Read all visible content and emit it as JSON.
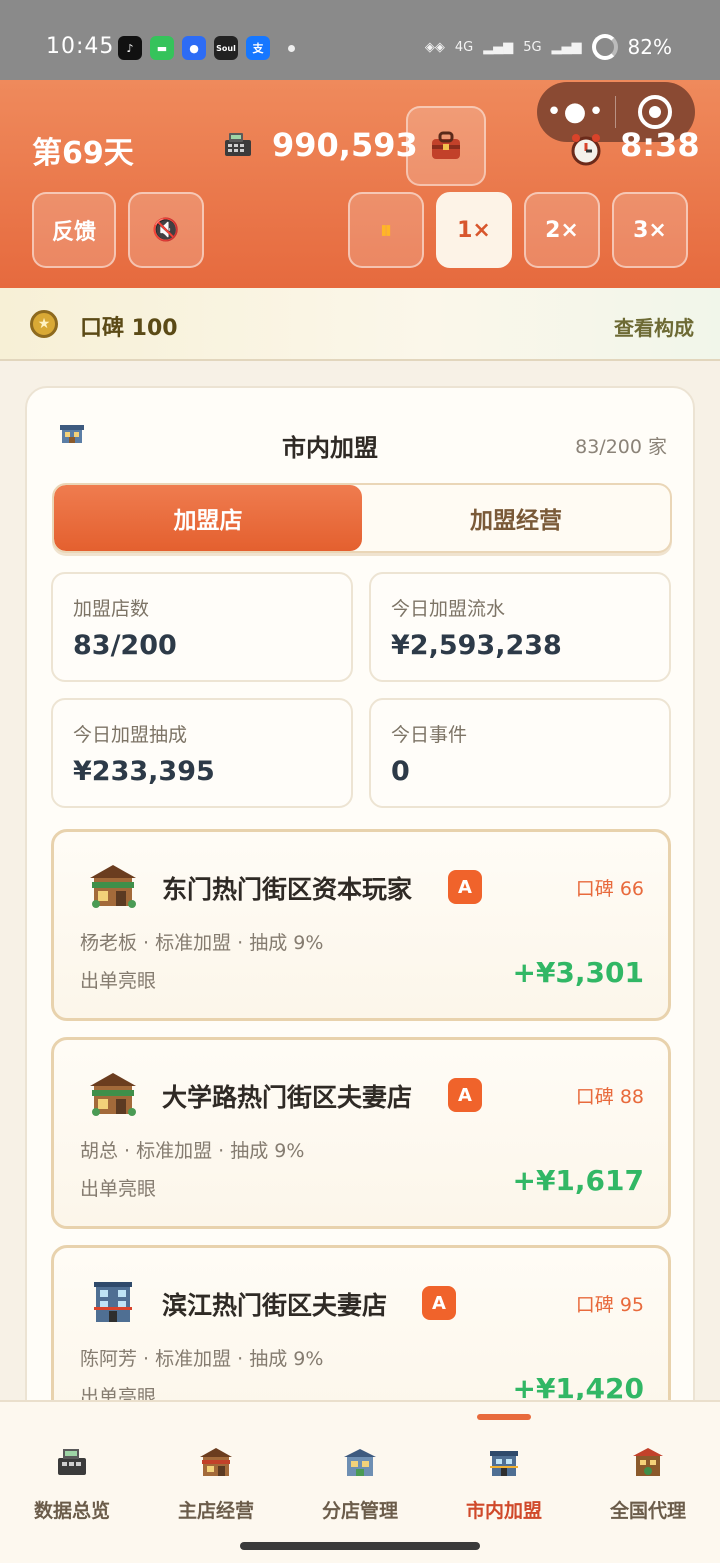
{
  "status_bar": {
    "time": "10:45",
    "battery": "82%",
    "apps": [
      {
        "icon": "tiktok-icon",
        "glyph": "♪",
        "color": "#111111"
      },
      {
        "icon": "messages-icon",
        "glyph": "▬",
        "color": "#35c35b"
      },
      {
        "icon": "browser-icon",
        "glyph": "●",
        "color": "#2d6cf5"
      },
      {
        "icon": "soul-icon",
        "glyph": "Soul",
        "color": "#222222"
      },
      {
        "icon": "alipay-icon",
        "glyph": "支",
        "color": "#1677ff"
      }
    ],
    "signal_text": [
      "4G",
      "5G"
    ]
  },
  "header": {
    "day": "第69天",
    "money": "990,593",
    "clock": "8:38",
    "buttons": {
      "feedback": "反馈",
      "mute_icon": "🔇",
      "pause_icon": "⏸",
      "speed_1": "1×",
      "speed_2": "2×",
      "speed_3": "3×"
    },
    "active_speed": "1×"
  },
  "capsule": {
    "more": "•●•"
  },
  "reputation": {
    "label": "口碑 100",
    "link": "查看构成"
  },
  "card": {
    "title": "市内加盟",
    "count": "83/200 家",
    "tabs": [
      "加盟店",
      "加盟经营"
    ],
    "active_tab": 0,
    "stats": [
      {
        "label": "加盟店数",
        "value": "83/200"
      },
      {
        "label": "今日加盟流水",
        "value": "¥2,593,238"
      },
      {
        "label": "今日加盟抽成",
        "value": "¥233,395"
      },
      {
        "label": "今日事件",
        "value": "0"
      }
    ],
    "stores": [
      {
        "name": "东门热门街区资本玩家",
        "grade": "A",
        "reputation": "口碑 66",
        "meta": "杨老板 · 标准加盟 · 抽成 9%",
        "event": "出单亮眼",
        "income": "+¥3,301"
      },
      {
        "name": "大学路热门街区夫妻店",
        "grade": "A",
        "reputation": "口碑 88",
        "meta": "胡总 · 标准加盟 · 抽成 9%",
        "event": "出单亮眼",
        "income": "+¥1,617"
      },
      {
        "name": "滨江热门街区夫妻店",
        "grade": "A",
        "reputation": "口碑 95",
        "meta": "陈阿芳 · 标准加盟 · 抽成 9%",
        "event": "出单亮眼",
        "income": "+¥1,420"
      }
    ]
  },
  "bottom_nav": {
    "items": [
      "数据总览",
      "主店经营",
      "分店管理",
      "市内加盟",
      "全国代理"
    ],
    "active": "市内加盟"
  }
}
